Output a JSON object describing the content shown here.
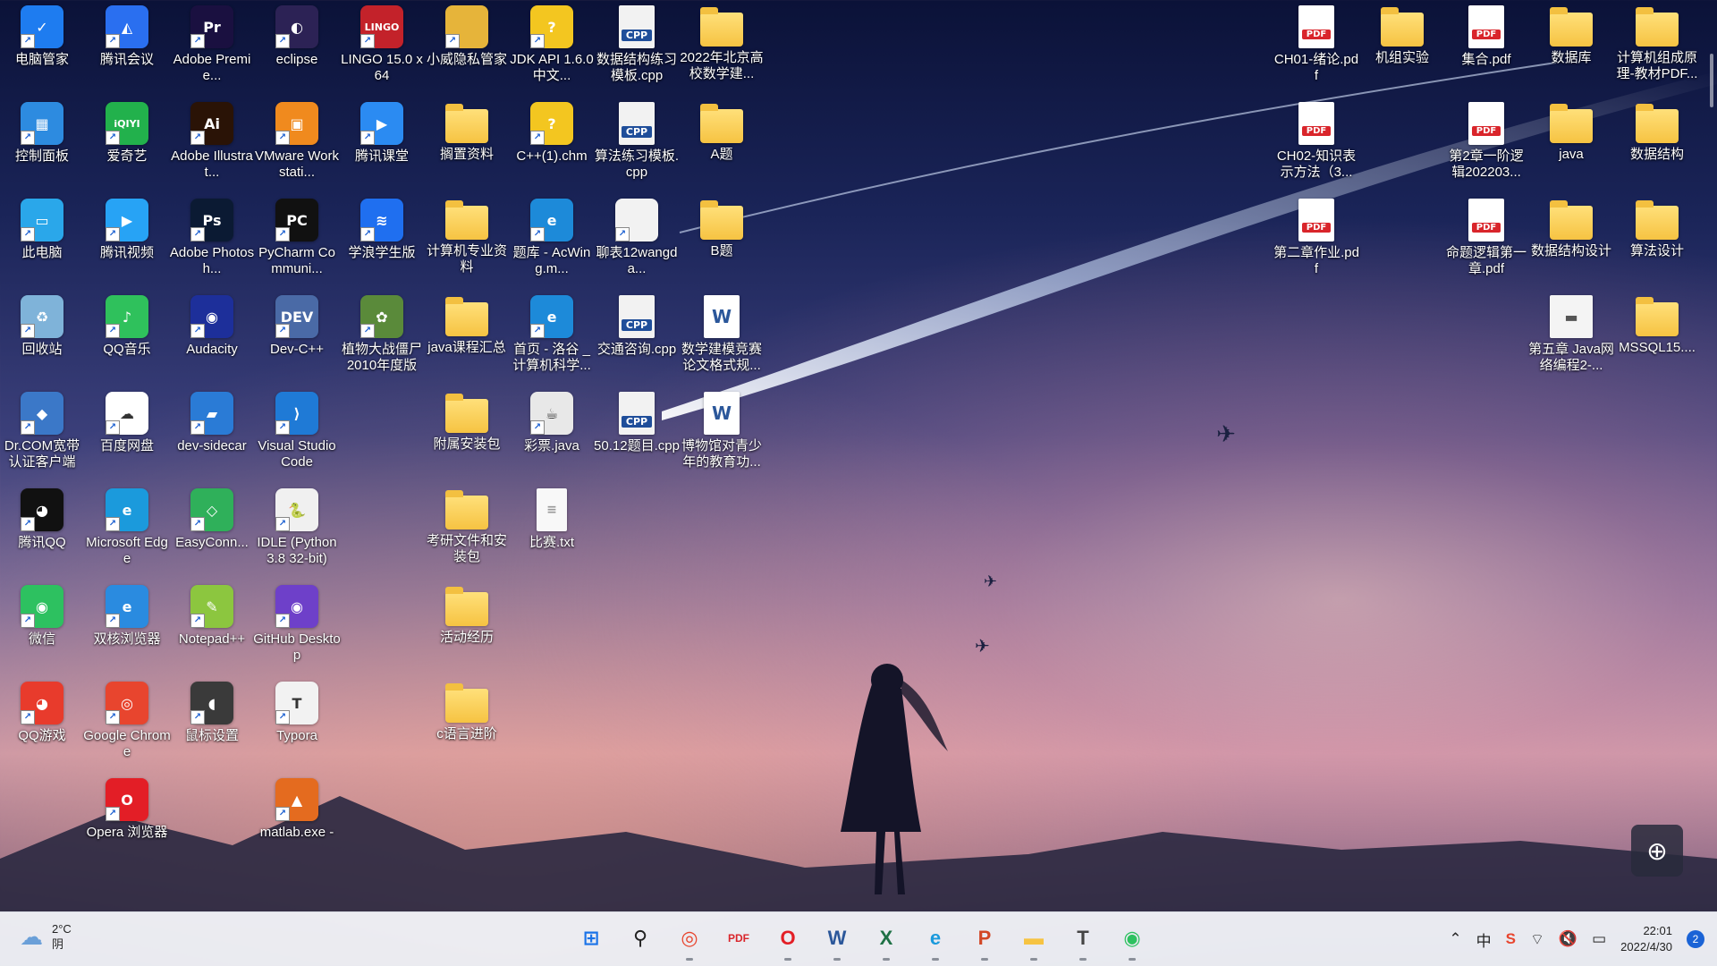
{
  "desktop": {
    "icons": [
      {
        "id": "c0r0",
        "label": "电脑管家",
        "glyph": "✓",
        "color": "#1e7cf0"
      },
      {
        "id": "c1r0",
        "label": "腾讯会议",
        "glyph": "◭",
        "color": "#2a6ff0"
      },
      {
        "id": "c2r0",
        "label": "Adobe Premie...",
        "glyph": "Pr",
        "color": "#1a1040"
      },
      {
        "id": "c3r0",
        "label": "eclipse",
        "glyph": "◐",
        "color": "#2c2255"
      },
      {
        "id": "c4r0",
        "label": "LINGO 15.0 x64",
        "glyph": "LINGO",
        "color": "#c3222a"
      },
      {
        "id": "c5r0",
        "label": "小威隐私管家",
        "glyph": "",
        "color": "#e6b43a"
      },
      {
        "id": "c6r0",
        "label": "JDK API 1.6.0 中文...",
        "glyph": "?",
        "color": "#f3c620"
      },
      {
        "id": "c7r0",
        "label": "数据结构练习模板.cpp",
        "glyph": "",
        "color": "#f2f2f2"
      },
      {
        "id": "c8r0",
        "label": "2022年北京高校数学建...",
        "glyph": "",
        "color": "#f6c342"
      },
      {
        "id": "c0r1",
        "label": "控制面板",
        "glyph": "▦",
        "color": "#2d8be0"
      },
      {
        "id": "c1r1",
        "label": "爱奇艺",
        "glyph": "iQIYI",
        "color": "#22b14c"
      },
      {
        "id": "c2r1",
        "label": "Adobe Illustrat...",
        "glyph": "Ai",
        "color": "#2a1306"
      },
      {
        "id": "c3r1",
        "label": "VMware Workstati...",
        "glyph": "▣",
        "color": "#f08a1e"
      },
      {
        "id": "c4r1",
        "label": "腾讯课堂",
        "glyph": "▶",
        "color": "#2b8bf2"
      },
      {
        "id": "c5r1",
        "label": "搁置资料",
        "glyph": "",
        "color": "#f6c342"
      },
      {
        "id": "c6r1",
        "label": "C++(1).chm",
        "glyph": "?",
        "color": "#f3c620"
      },
      {
        "id": "c7r1",
        "label": "算法练习模板.cpp",
        "glyph": "",
        "color": "#f2f2f2"
      },
      {
        "id": "c8r1",
        "label": "A题",
        "glyph": "",
        "color": "#f6c342"
      },
      {
        "id": "c0r2",
        "label": "此电脑",
        "glyph": "▭",
        "color": "#2aa7ea"
      },
      {
        "id": "c1r2",
        "label": "腾讯视频",
        "glyph": "▶",
        "color": "#27a3f5"
      },
      {
        "id": "c2r2",
        "label": "Adobe Photosh...",
        "glyph": "Ps",
        "color": "#0b1a33"
      },
      {
        "id": "c3r2",
        "label": "PyCharm Communi...",
        "glyph": "PC",
        "color": "#111111"
      },
      {
        "id": "c4r2",
        "label": "学浪学生版",
        "glyph": "≋",
        "color": "#1f6ff0"
      },
      {
        "id": "c5r2",
        "label": "计算机专业资料",
        "glyph": "",
        "color": "#f6c342"
      },
      {
        "id": "c6r2",
        "label": "题库 - AcWing.m...",
        "glyph": "e",
        "color": "#1d8ad9"
      },
      {
        "id": "c7r2",
        "label": "聊表12wangda...",
        "glyph": "",
        "color": "#f2f2f2"
      },
      {
        "id": "c8r2",
        "label": "B题",
        "glyph": "",
        "color": "#f6c342"
      },
      {
        "id": "c0r3",
        "label": "回收站",
        "glyph": "♻",
        "color": "#7fb3d9"
      },
      {
        "id": "c1r3",
        "label": "QQ音乐",
        "glyph": "♪",
        "color": "#2fc15c"
      },
      {
        "id": "c2r3",
        "label": "Audacity",
        "glyph": "◉",
        "color": "#1d2f9a"
      },
      {
        "id": "c3r3",
        "label": "Dev-C++",
        "glyph": "DEV",
        "color": "#4a6aa6"
      },
      {
        "id": "c4r3",
        "label": "植物大战僵尸2010年度版",
        "glyph": "✿",
        "color": "#5a8a3a"
      },
      {
        "id": "c5r3",
        "label": "java课程汇总",
        "glyph": "",
        "color": "#f6c342"
      },
      {
        "id": "c6r3",
        "label": "首页 - 洛谷 _ 计算机科学...",
        "glyph": "e",
        "color": "#1d8ad9"
      },
      {
        "id": "c7r3",
        "label": "交通咨询.cpp",
        "glyph": "",
        "color": "#f2f2f2"
      },
      {
        "id": "c8r3",
        "label": "数学建模竞赛论文格式规...",
        "glyph": "W",
        "color": "#ffffff"
      },
      {
        "id": "c0r4",
        "label": "Dr.COM宽带认证客户端",
        "glyph": "◆",
        "color": "#3b78c8"
      },
      {
        "id": "c1r4",
        "label": "百度网盘",
        "glyph": "☁",
        "color": "#ffffff"
      },
      {
        "id": "c2r4",
        "label": "dev-sidecar",
        "glyph": "▰",
        "color": "#2a7bd6"
      },
      {
        "id": "c3r4",
        "label": "Visual Studio Code",
        "glyph": "⟩",
        "color": "#1f7ad6"
      },
      {
        "id": "c5r4",
        "label": "附属安装包",
        "glyph": "",
        "color": "#f6c342"
      },
      {
        "id": "c6r4",
        "label": "彩票.java",
        "glyph": "☕",
        "color": "#e8e8e8"
      },
      {
        "id": "c7r4",
        "label": "50.12题目.cpp",
        "glyph": "",
        "color": "#f2f2f2"
      },
      {
        "id": "c8r4",
        "label": "博物馆对青少年的教育功...",
        "glyph": "W",
        "color": "#ffffff"
      },
      {
        "id": "c0r5",
        "label": "腾讯QQ",
        "glyph": "◕",
        "color": "#111111"
      },
      {
        "id": "c1r5",
        "label": "Microsoft Edge",
        "glyph": "e",
        "color": "#1b9adc"
      },
      {
        "id": "c2r5",
        "label": "EasyConn...",
        "glyph": "◇",
        "color": "#2fb05a"
      },
      {
        "id": "c3r5",
        "label": "IDLE (Python 3.8 32-bit)",
        "glyph": "🐍",
        "color": "#f0f0f0"
      },
      {
        "id": "c5r5",
        "label": "考研文件和安装包",
        "glyph": "",
        "color": "#f6c342"
      },
      {
        "id": "c6r5",
        "label": "比赛.txt",
        "glyph": "≡",
        "color": "#f8f8f8"
      },
      {
        "id": "c0r6",
        "label": "微信",
        "glyph": "◉",
        "color": "#2dc160"
      },
      {
        "id": "c1r6",
        "label": "双核浏览器",
        "glyph": "e",
        "color": "#2a8be0"
      },
      {
        "id": "c2r6",
        "label": "Notepad++",
        "glyph": "✎",
        "color": "#8cc63f"
      },
      {
        "id": "c3r6",
        "label": "GitHub Desktop",
        "glyph": "◉",
        "color": "#6e40c9"
      },
      {
        "id": "c5r6",
        "label": "活动经历",
        "glyph": "",
        "color": "#f6c342"
      },
      {
        "id": "c0r7",
        "label": "QQ游戏",
        "glyph": "◕",
        "color": "#e83b2c"
      },
      {
        "id": "c1r7",
        "label": "Google Chrome",
        "glyph": "◎",
        "color": "#e8452e"
      },
      {
        "id": "c2r7",
        "label": "鼠标设置",
        "glyph": "◖",
        "color": "#3a3a3a"
      },
      {
        "id": "c3r7",
        "label": "Typora",
        "glyph": "T",
        "color": "#f2f2f2"
      },
      {
        "id": "c5r7",
        "label": "c语言进阶",
        "glyph": "",
        "color": "#f6c342"
      },
      {
        "id": "c1r8",
        "label": "Opera 浏览器",
        "glyph": "O",
        "color": "#e31e26"
      },
      {
        "id": "c3r8",
        "label": "matlab.exe -",
        "glyph": "▲",
        "color": "#e46b1f"
      }
    ],
    "right_icons": [
      {
        "id": "r0a",
        "label": "CH01-绪论.pdf",
        "kind": "pdf"
      },
      {
        "id": "r0b",
        "label": "机组实验",
        "kind": "folder"
      },
      {
        "id": "r0c",
        "label": "集合.pdf",
        "kind": "pdf"
      },
      {
        "id": "r0d",
        "label": "数据库",
        "kind": "folder"
      },
      {
        "id": "r0e",
        "label": "计算机组成原理-教材PDF...",
        "kind": "folder"
      },
      {
        "id": "r1a",
        "label": "CH02-知识表示方法（3...",
        "kind": "pdf"
      },
      {
        "id": "r1c",
        "label": "第2章一阶逻辑202203...",
        "kind": "pdf"
      },
      {
        "id": "r1d",
        "label": "java",
        "kind": "folder"
      },
      {
        "id": "r1e",
        "label": "数据结构",
        "kind": "folder"
      },
      {
        "id": "r2a",
        "label": "第二章作业.pdf",
        "kind": "pdf"
      },
      {
        "id": "r2c",
        "label": "命题逻辑第一章.pdf",
        "kind": "pdf"
      },
      {
        "id": "r2d",
        "label": "数据结构设计",
        "kind": "folder"
      },
      {
        "id": "r2e",
        "label": "算法设计",
        "kind": "folder"
      },
      {
        "id": "r3d",
        "label": "第五章 Java网络编程2-...",
        "kind": "card"
      },
      {
        "id": "r3e",
        "label": "MSSQL15....",
        "kind": "folder"
      }
    ]
  },
  "taskbar": {
    "weather": {
      "temp": "2°C",
      "condition": "阴"
    },
    "apps": [
      {
        "name": "start-button",
        "glyph": "⊞",
        "color": "#1a73e8"
      },
      {
        "name": "search-button",
        "glyph": "⚲",
        "color": "#222222"
      },
      {
        "name": "chrome-taskbar",
        "glyph": "◎",
        "color": "#e8452e",
        "running": true
      },
      {
        "name": "pdf-reader-taskbar",
        "glyph": "PDF",
        "color": "#d9252b",
        "running": false
      },
      {
        "name": "opera-taskbar",
        "glyph": "O",
        "color": "#e31e26",
        "running": true
      },
      {
        "name": "word-taskbar",
        "glyph": "W",
        "color": "#2b579a",
        "running": true
      },
      {
        "name": "excel-taskbar",
        "glyph": "X",
        "color": "#1e7145",
        "running": true
      },
      {
        "name": "edge-taskbar",
        "glyph": "e",
        "color": "#1b9adc",
        "running": true
      },
      {
        "name": "powerpoint-taskbar",
        "glyph": "P",
        "color": "#d24726",
        "running": true
      },
      {
        "name": "file-explorer-taskbar",
        "glyph": "▬",
        "color": "#f6c342",
        "running": true
      },
      {
        "name": "typora-taskbar",
        "glyph": "T",
        "color": "#444444",
        "running": true
      },
      {
        "name": "wechat-taskbar",
        "glyph": "◉",
        "color": "#2dc160",
        "running": true
      }
    ],
    "tray": {
      "input_method": "中",
      "time": "22:01",
      "date": "2022/4/30",
      "notifications": "2"
    }
  }
}
